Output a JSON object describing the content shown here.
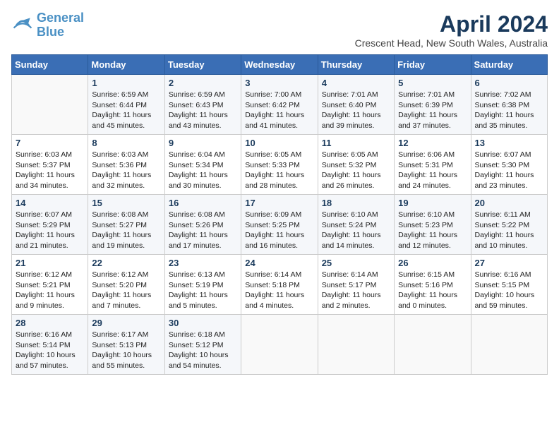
{
  "header": {
    "logo_line1": "General",
    "logo_line2": "Blue",
    "month_year": "April 2024",
    "location": "Crescent Head, New South Wales, Australia"
  },
  "days_of_week": [
    "Sunday",
    "Monday",
    "Tuesday",
    "Wednesday",
    "Thursday",
    "Friday",
    "Saturday"
  ],
  "weeks": [
    [
      {
        "day": "",
        "info": ""
      },
      {
        "day": "1",
        "info": "Sunrise: 6:59 AM\nSunset: 6:44 PM\nDaylight: 11 hours\nand 45 minutes."
      },
      {
        "day": "2",
        "info": "Sunrise: 6:59 AM\nSunset: 6:43 PM\nDaylight: 11 hours\nand 43 minutes."
      },
      {
        "day": "3",
        "info": "Sunrise: 7:00 AM\nSunset: 6:42 PM\nDaylight: 11 hours\nand 41 minutes."
      },
      {
        "day": "4",
        "info": "Sunrise: 7:01 AM\nSunset: 6:40 PM\nDaylight: 11 hours\nand 39 minutes."
      },
      {
        "day": "5",
        "info": "Sunrise: 7:01 AM\nSunset: 6:39 PM\nDaylight: 11 hours\nand 37 minutes."
      },
      {
        "day": "6",
        "info": "Sunrise: 7:02 AM\nSunset: 6:38 PM\nDaylight: 11 hours\nand 35 minutes."
      }
    ],
    [
      {
        "day": "7",
        "info": "Sunrise: 6:03 AM\nSunset: 5:37 PM\nDaylight: 11 hours\nand 34 minutes."
      },
      {
        "day": "8",
        "info": "Sunrise: 6:03 AM\nSunset: 5:36 PM\nDaylight: 11 hours\nand 32 minutes."
      },
      {
        "day": "9",
        "info": "Sunrise: 6:04 AM\nSunset: 5:34 PM\nDaylight: 11 hours\nand 30 minutes."
      },
      {
        "day": "10",
        "info": "Sunrise: 6:05 AM\nSunset: 5:33 PM\nDaylight: 11 hours\nand 28 minutes."
      },
      {
        "day": "11",
        "info": "Sunrise: 6:05 AM\nSunset: 5:32 PM\nDaylight: 11 hours\nand 26 minutes."
      },
      {
        "day": "12",
        "info": "Sunrise: 6:06 AM\nSunset: 5:31 PM\nDaylight: 11 hours\nand 24 minutes."
      },
      {
        "day": "13",
        "info": "Sunrise: 6:07 AM\nSunset: 5:30 PM\nDaylight: 11 hours\nand 23 minutes."
      }
    ],
    [
      {
        "day": "14",
        "info": "Sunrise: 6:07 AM\nSunset: 5:29 PM\nDaylight: 11 hours\nand 21 minutes."
      },
      {
        "day": "15",
        "info": "Sunrise: 6:08 AM\nSunset: 5:27 PM\nDaylight: 11 hours\nand 19 minutes."
      },
      {
        "day": "16",
        "info": "Sunrise: 6:08 AM\nSunset: 5:26 PM\nDaylight: 11 hours\nand 17 minutes."
      },
      {
        "day": "17",
        "info": "Sunrise: 6:09 AM\nSunset: 5:25 PM\nDaylight: 11 hours\nand 16 minutes."
      },
      {
        "day": "18",
        "info": "Sunrise: 6:10 AM\nSunset: 5:24 PM\nDaylight: 11 hours\nand 14 minutes."
      },
      {
        "day": "19",
        "info": "Sunrise: 6:10 AM\nSunset: 5:23 PM\nDaylight: 11 hours\nand 12 minutes."
      },
      {
        "day": "20",
        "info": "Sunrise: 6:11 AM\nSunset: 5:22 PM\nDaylight: 11 hours\nand 10 minutes."
      }
    ],
    [
      {
        "day": "21",
        "info": "Sunrise: 6:12 AM\nSunset: 5:21 PM\nDaylight: 11 hours\nand 9 minutes."
      },
      {
        "day": "22",
        "info": "Sunrise: 6:12 AM\nSunset: 5:20 PM\nDaylight: 11 hours\nand 7 minutes."
      },
      {
        "day": "23",
        "info": "Sunrise: 6:13 AM\nSunset: 5:19 PM\nDaylight: 11 hours\nand 5 minutes."
      },
      {
        "day": "24",
        "info": "Sunrise: 6:14 AM\nSunset: 5:18 PM\nDaylight: 11 hours\nand 4 minutes."
      },
      {
        "day": "25",
        "info": "Sunrise: 6:14 AM\nSunset: 5:17 PM\nDaylight: 11 hours\nand 2 minutes."
      },
      {
        "day": "26",
        "info": "Sunrise: 6:15 AM\nSunset: 5:16 PM\nDaylight: 11 hours\nand 0 minutes."
      },
      {
        "day": "27",
        "info": "Sunrise: 6:16 AM\nSunset: 5:15 PM\nDaylight: 10 hours\nand 59 minutes."
      }
    ],
    [
      {
        "day": "28",
        "info": "Sunrise: 6:16 AM\nSunset: 5:14 PM\nDaylight: 10 hours\nand 57 minutes."
      },
      {
        "day": "29",
        "info": "Sunrise: 6:17 AM\nSunset: 5:13 PM\nDaylight: 10 hours\nand 55 minutes."
      },
      {
        "day": "30",
        "info": "Sunrise: 6:18 AM\nSunset: 5:12 PM\nDaylight: 10 hours\nand 54 minutes."
      },
      {
        "day": "",
        "info": ""
      },
      {
        "day": "",
        "info": ""
      },
      {
        "day": "",
        "info": ""
      },
      {
        "day": "",
        "info": ""
      }
    ]
  ]
}
